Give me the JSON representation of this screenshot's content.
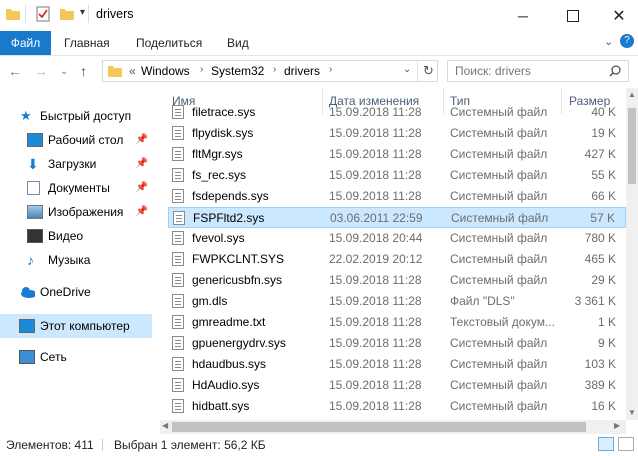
{
  "window": {
    "title": "drivers"
  },
  "ribbon": {
    "tabs": [
      "Файл",
      "Главная",
      "Поделиться",
      "Вид"
    ]
  },
  "address": {
    "path": [
      "Windows",
      "System32",
      "drivers"
    ],
    "overflow": "«"
  },
  "search": {
    "placeholder": "Поиск: drivers"
  },
  "nav": {
    "items": [
      {
        "label": "Быстрый доступ",
        "icon": "star-icon"
      },
      {
        "label": "Рабочий стол",
        "icon": "desktop-icon",
        "pinned": true
      },
      {
        "label": "Загрузки",
        "icon": "download-icon",
        "pinned": true
      },
      {
        "label": "Документы",
        "icon": "documents-icon",
        "pinned": true
      },
      {
        "label": "Изображения",
        "icon": "pictures-icon",
        "pinned": true
      },
      {
        "label": "Видео",
        "icon": "video-icon"
      },
      {
        "label": "Музыка",
        "icon": "music-icon"
      },
      {
        "label": "OneDrive",
        "icon": "onedrive-icon"
      },
      {
        "label": "Этот компьютер",
        "icon": "computer-icon"
      },
      {
        "label": "Сеть",
        "icon": "network-icon"
      }
    ]
  },
  "columns": {
    "name": "Имя",
    "date": "Дата изменения",
    "type": "Тип",
    "size": "Размер"
  },
  "files": [
    {
      "name": "filetrace.sys",
      "date": "15.09.2018 11:28",
      "type": "Системный файл",
      "size": "40 K"
    },
    {
      "name": "flpydisk.sys",
      "date": "15.09.2018 11:28",
      "type": "Системный файл",
      "size": "19 K"
    },
    {
      "name": "fltMgr.sys",
      "date": "15.09.2018 11:28",
      "type": "Системный файл",
      "size": "427 K"
    },
    {
      "name": "fs_rec.sys",
      "date": "15.09.2018 11:28",
      "type": "Системный файл",
      "size": "55 K"
    },
    {
      "name": "fsdepends.sys",
      "date": "15.09.2018 11:28",
      "type": "Системный файл",
      "size": "66 K"
    },
    {
      "name": "FSPFltd2.sys",
      "date": "03.06.2011 22:59",
      "type": "Системный файл",
      "size": "57 K",
      "selected": true
    },
    {
      "name": "fvevol.sys",
      "date": "15.09.2018 20:44",
      "type": "Системный файл",
      "size": "780 K"
    },
    {
      "name": "FWPKCLNT.SYS",
      "date": "22.02.2019 20:12",
      "type": "Системный файл",
      "size": "465 K"
    },
    {
      "name": "genericusbfn.sys",
      "date": "15.09.2018 11:28",
      "type": "Системный файл",
      "size": "29 K"
    },
    {
      "name": "gm.dls",
      "date": "15.09.2018 11:28",
      "type": "Файл \"DLS\"",
      "size": "3 361 K"
    },
    {
      "name": "gmreadme.txt",
      "date": "15.09.2018 11:28",
      "type": "Текстовый докум...",
      "size": "1 K"
    },
    {
      "name": "gpuenergydrv.sys",
      "date": "15.09.2018 11:28",
      "type": "Системный файл",
      "size": "9 K"
    },
    {
      "name": "hdaudbus.sys",
      "date": "15.09.2018 11:28",
      "type": "Системный файл",
      "size": "103 K"
    },
    {
      "name": "HdAudio.sys",
      "date": "15.09.2018 11:28",
      "type": "Системный файл",
      "size": "389 K"
    },
    {
      "name": "hidbatt.sys",
      "date": "15.09.2018 11:28",
      "type": "Системный файл",
      "size": "16 K"
    }
  ],
  "status": {
    "count": "Элементов: 411",
    "selection": "Выбран 1 элемент: 56,2 КБ"
  },
  "colors": {
    "accent": "#1979ca",
    "selection": "#cce8ff",
    "header": "#4c607a"
  }
}
